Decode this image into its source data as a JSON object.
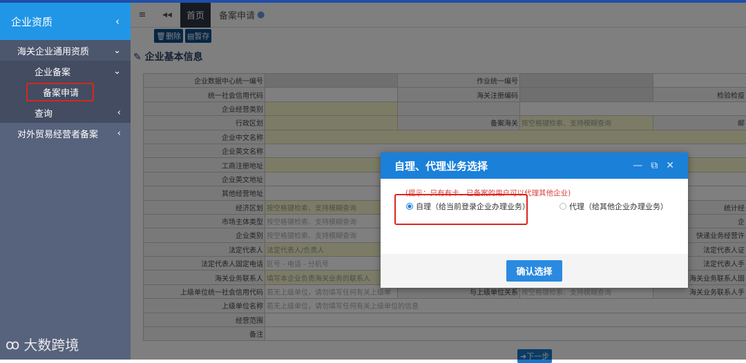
{
  "sidebar": {
    "title": "企业资质",
    "items": [
      {
        "label": "海关企业通用资质",
        "chevron": "⌄"
      },
      {
        "label": "企业备案",
        "chevron": "⌄"
      },
      {
        "label": "备案申请",
        "chevron": ""
      },
      {
        "label": "查询",
        "chevron": "‹"
      },
      {
        "label": "对外贸易经营者备案",
        "chevron": "‹"
      }
    ]
  },
  "watermark": "大数跨境",
  "tabs": {
    "menu": "≡",
    "back": "◀◀",
    "home": "首页",
    "current": "备案申请"
  },
  "toolbar": {
    "delete": "删除",
    "save": "暂存"
  },
  "section_title": "企业基本信息",
  "form_rows": [
    {
      "cells": [
        [
          "lab",
          "企业数据中心统一编号"
        ],
        [
          "g",
          ""
        ],
        [
          "lab2",
          "作业统一编号"
        ],
        [
          "g",
          ""
        ],
        [
          "val",
          ""
        ]
      ]
    },
    {
      "cells": [
        [
          "lab",
          "统一社会信用代码"
        ],
        [
          "val",
          ""
        ],
        [
          "lab2",
          "海关注册编码"
        ],
        [
          "g",
          ""
        ],
        [
          "lab3",
          "检验检疫"
        ]
      ]
    },
    {
      "cells": [
        [
          "lab",
          "企业经营类别"
        ],
        [
          "y",
          ""
        ],
        [
          "lab2",
          ""
        ],
        [
          "val",
          "",
          2
        ]
      ]
    },
    {
      "cells": [
        [
          "lab",
          "行政区划"
        ],
        [
          "y",
          ""
        ],
        [
          "lab2",
          "备案海关"
        ],
        [
          "y",
          "按空格键检索、支持模糊查询"
        ],
        [
          "lab3",
          "邮"
        ]
      ]
    },
    {
      "cells": [
        [
          "lab",
          "企业中文名称"
        ],
        [
          "y",
          "",
          4
        ]
      ]
    },
    {
      "cells": [
        [
          "lab",
          "企业英文名称"
        ],
        [
          "val",
          "",
          4
        ]
      ]
    },
    {
      "cells": [
        [
          "lab",
          "工商注册地址"
        ],
        [
          "y",
          "",
          4
        ]
      ]
    },
    {
      "cells": [
        [
          "lab",
          "企业英文地址"
        ],
        [
          "val",
          "",
          4
        ]
      ]
    },
    {
      "cells": [
        [
          "lab",
          "其他经营地址"
        ],
        [
          "val",
          "",
          4
        ]
      ]
    },
    {
      "cells": [
        [
          "lab",
          "经济区划"
        ],
        [
          "y",
          "按空格键检索、支持模糊查询"
        ],
        [
          "val",
          "",
          2
        ],
        [
          "lab3",
          "统计经"
        ]
      ]
    },
    {
      "cells": [
        [
          "lab",
          "市场主体类型"
        ],
        [
          "val",
          "按空格键检索、支持模糊查询"
        ],
        [
          "val",
          "",
          2
        ],
        [
          "lab3",
          "企"
        ]
      ]
    },
    {
      "cells": [
        [
          "lab",
          "企业类别"
        ],
        [
          "val",
          "按空格键检索、支持模糊查询"
        ],
        [
          "val",
          "",
          2
        ],
        [
          "lab3",
          "快递业务经营许"
        ]
      ]
    },
    {
      "cells": [
        [
          "lab",
          "法定代表人"
        ],
        [
          "y",
          "法定代表人/负责人"
        ],
        [
          "val",
          "",
          2
        ],
        [
          "lab3",
          "法定代表人证"
        ]
      ]
    },
    {
      "cells": [
        [
          "lab",
          "法定代表人固定电话"
        ],
        [
          "val",
          "  区号  -     电话     -   分机号"
        ],
        [
          "val",
          "",
          2
        ],
        [
          "lab3",
          "法定代表人手"
        ]
      ]
    },
    {
      "cells": [
        [
          "lab",
          "海关业务联系人"
        ],
        [
          "y",
          "填写本企业负责海关业务的联系人"
        ],
        [
          "val",
          "",
          2
        ],
        [
          "lab3",
          "海关业务联系人固"
        ]
      ]
    },
    {
      "cells": [
        [
          "lab",
          "上级单位统一社会信用代码"
        ],
        [
          "val",
          "若无上级单位，请勿填写任何有关上级单"
        ],
        [
          "lab2",
          "与上级单位关系"
        ],
        [
          "val",
          "按空格键检索、支持模糊查询"
        ],
        [
          "lab3",
          "海关业务联系人手"
        ]
      ]
    },
    {
      "cells": [
        [
          "lab",
          "上级单位名称"
        ],
        [
          "val",
          "若无上级单位，请勿填写任何有关上级单位的信息",
          4
        ]
      ]
    },
    {
      "cells": [
        [
          "lab",
          "经营范围"
        ],
        [
          "val",
          "",
          4
        ]
      ]
    },
    {
      "cells": [
        [
          "lab",
          "备注"
        ],
        [
          "val",
          "",
          4
        ]
      ]
    }
  ],
  "next_button": "下一步",
  "modal": {
    "title": "自理、代理业务选择",
    "tip": "(提示：只有有卡、已备案的用户可以代理其他企业)",
    "option_self": "自理（给当前登录企业办理业务）",
    "option_agent": "代理（给其他企业办理业务）",
    "selected": "self",
    "confirm": "确认选择",
    "minimize": "—",
    "maximize": "⧉",
    "close": "✕"
  }
}
